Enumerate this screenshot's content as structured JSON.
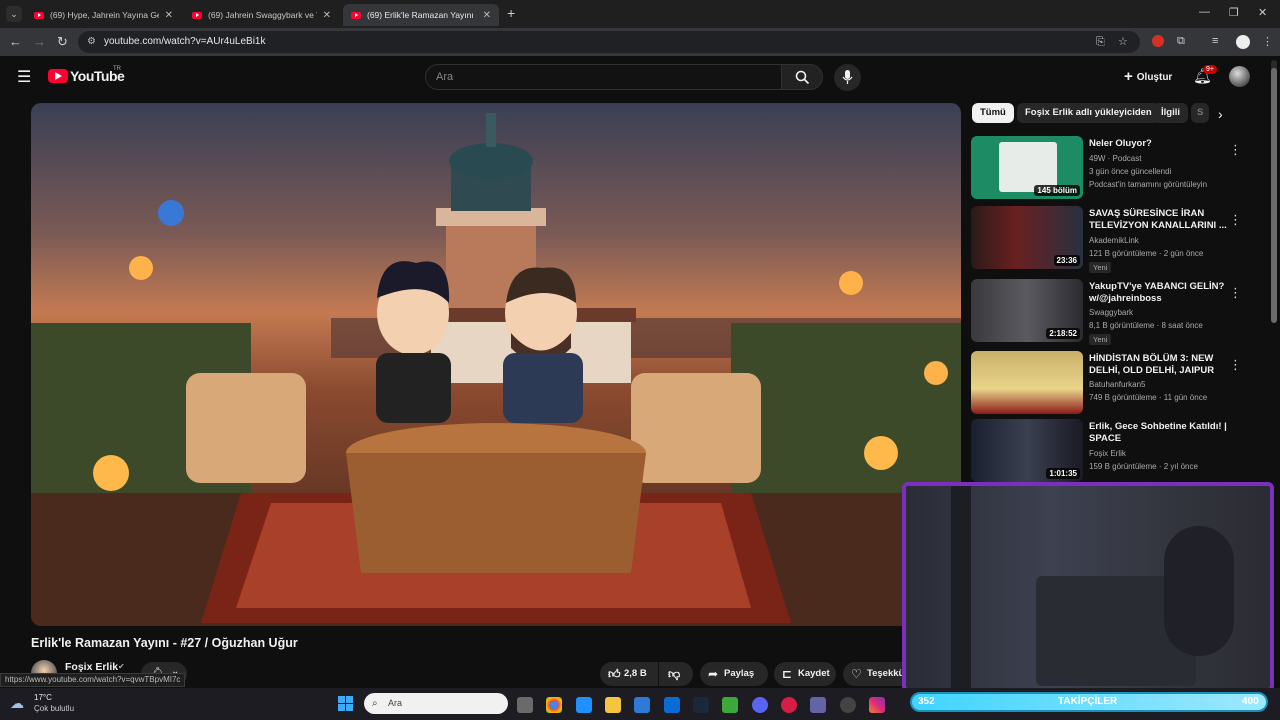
{
  "browser": {
    "tabs": [
      {
        "title": "(69) Hype, Jahrein Yayına Geliyo",
        "active": false
      },
      {
        "title": "(69) Jahrein Swaggybark ve Yak",
        "active": false
      },
      {
        "title": "(69) Erlik'le Ramazan Yayını",
        "active": true
      }
    ],
    "url": "youtube.com/watch?v=AUr4uLeBi1k"
  },
  "youtube": {
    "logo_text": "YouTube",
    "region": "TR",
    "search_placeholder": "Ara",
    "create_label": "Oluştur",
    "notif_count": "9+"
  },
  "video": {
    "title": "Erlik'le Ramazan Yayını - #27 / Oğuzhan Uğur",
    "channel": "Foşix Erlik",
    "likes": "2,8 B",
    "share_label": "Paylaş",
    "save_label": "Kaydet",
    "thanks_label": "Teşekkü"
  },
  "chips": [
    "Tümü",
    "Foşix Erlik adlı yükleyiciden",
    "İlgili",
    "S"
  ],
  "recommendations": [
    {
      "title": "Neler Oluyor?",
      "line1": "49W · Podcast",
      "line2": "3 gün önce güncellendi",
      "line3": "Podcast'in tamamını görüntüleyin",
      "overlay": "145 bölüm",
      "badge": ""
    },
    {
      "title": "SAVAŞ SÜRESİNCE İRAN TELEVİZYON KANALLARINI ...",
      "line1": "AkademikLink",
      "line2": "121 B görüntüleme · 2 gün önce",
      "line3": "",
      "overlay": "23:36",
      "badge": "Yeni"
    },
    {
      "title": "YakupTV'ye YABANCI GELİN? w/@jahreinboss",
      "line1": "Swaggybark",
      "line2": "8,1 B görüntüleme · 8 saat önce",
      "line3": "",
      "overlay": "2:18:52",
      "badge": "Yeni"
    },
    {
      "title": "HİNDİSTAN BÖLÜM 3: NEW DELHİ, OLD DELHİ, JAIPUR",
      "line1": "Batuhanfurkan5",
      "line2": "749 B görüntüleme · 11 gün önce",
      "line3": "",
      "overlay": "",
      "badge": ""
    },
    {
      "title": "Erlik, Gece Sohbetine Katıldı! | SPACE",
      "line1": "Foşix Erlik",
      "line2": "159 B görüntüleme · 2 yıl önce",
      "line3": "",
      "overlay": "1:01:35",
      "badge": ""
    }
  ],
  "status_url": "https://www.youtube.com/watch?v=qvwTBpvMI7c",
  "weather": {
    "temp": "17°C",
    "desc": "Çok bulutlu"
  },
  "taskbar_search": "Ara",
  "follow_bar": {
    "left": "352",
    "label": "TAKİPÇİLER",
    "right": "400"
  }
}
